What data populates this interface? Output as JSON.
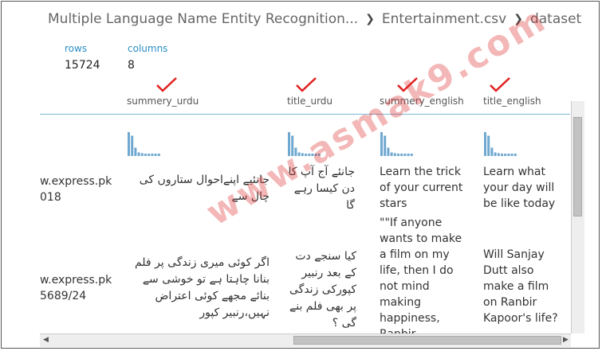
{
  "breadcrumb": {
    "items": [
      "Multiple Language Name Entity Recognition...",
      "Entertainment.csv",
      "dataset"
    ]
  },
  "stats": {
    "rows_label": "rows",
    "rows_value": "15724",
    "columns_label": "columns",
    "columns_value": "8"
  },
  "columns": [
    "summery_urdu",
    "title_urdu",
    "summery_english",
    "title_english"
  ],
  "rows": [
    {
      "url": "w.express.pk\n018",
      "summery_urdu": "جانئیے اپنےاحوال ستاروں کی چال سے",
      "title_urdu": "جانئے آج آپ کا دن کیسا رہے گا",
      "summery_english": "Learn the trick of your current stars",
      "title_english": "Learn what your day will be like today"
    },
    {
      "url": "w.express.pk\n5689/24",
      "summery_urdu": "اگر کوئی میری زندگی پر فلم بنانا چاہتا ہے تو خوشی سے بنائے مجھے کوئی اعتراض نہیں،رنبیر کپور",
      "title_urdu": "کیا سنجے دت کے بعد رنبیر کپورکی زندگی پر بھی فلم بنے گی ؟",
      "summery_english": "\"\"If anyone wants to make a film on my life, then I do not mind making happiness, Ranbir",
      "title_english": "Will Sanjay Dutt also make a film on Ranbir Kapoor's life?"
    }
  ],
  "histogram": {
    "bar_levels": [
      1.0,
      0.85,
      0.35,
      0.15,
      0.12,
      0.1,
      0.1,
      0.1,
      0.1,
      0.1
    ],
    "color": "#6fa8d0"
  },
  "watermark": {
    "text": "www.asmak9.com",
    "color": "#dc3232"
  },
  "colors": {
    "accent": "#2a8fc6",
    "tick": "#e02020"
  }
}
